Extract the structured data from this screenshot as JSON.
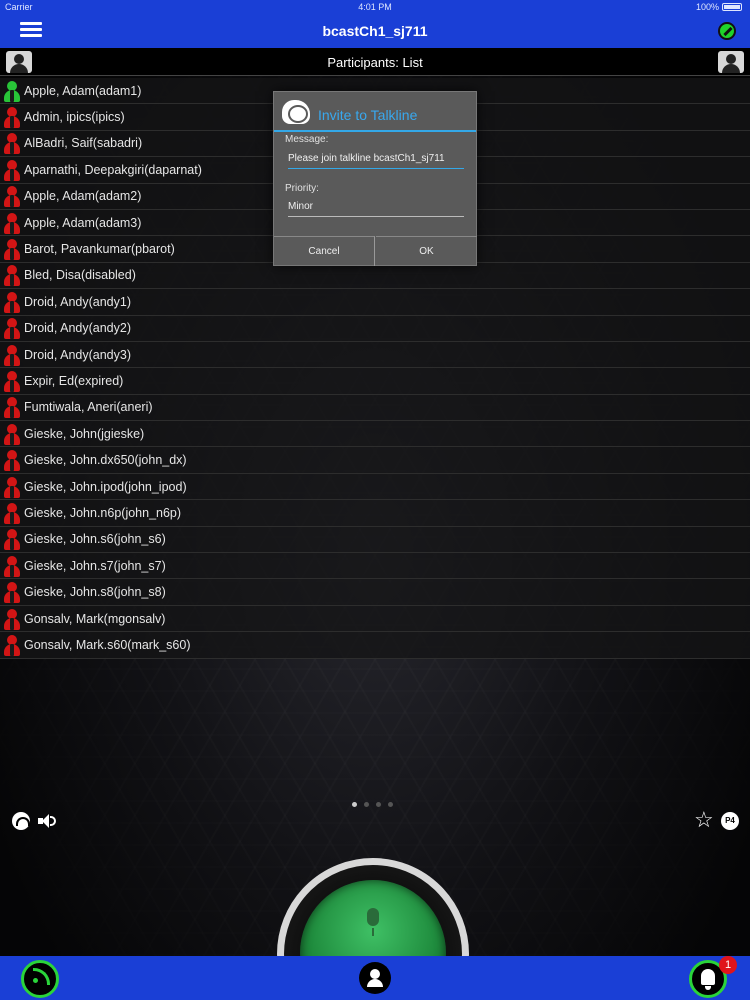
{
  "status_bar": {
    "carrier": "Carrier",
    "time": "4:01 PM",
    "battery": "100%"
  },
  "header": {
    "title": "bcastCh1_sj711"
  },
  "subheader": {
    "label": "Participants: List"
  },
  "participants": [
    {
      "name": "Apple, Adam(adam1)",
      "status": "online"
    },
    {
      "name": "Admin, ipics(ipics)",
      "status": "offline"
    },
    {
      "name": "AlBadri, Saif(sabadri)",
      "status": "offline"
    },
    {
      "name": "Aparnathi, Deepakgiri(daparnat)",
      "status": "offline"
    },
    {
      "name": "Apple, Adam(adam2)",
      "status": "offline"
    },
    {
      "name": "Apple, Adam(adam3)",
      "status": "offline"
    },
    {
      "name": "Barot, Pavankumar(pbarot)",
      "status": "offline"
    },
    {
      "name": "Bled, Disa(disabled)",
      "status": "offline"
    },
    {
      "name": "Droid, Andy(andy1)",
      "status": "offline"
    },
    {
      "name": "Droid, Andy(andy2)",
      "status": "offline"
    },
    {
      "name": "Droid, Andy(andy3)",
      "status": "offline"
    },
    {
      "name": "Expir, Ed(expired)",
      "status": "offline"
    },
    {
      "name": "Fumtiwala, Aneri(aneri)",
      "status": "offline"
    },
    {
      "name": "Gieske, John(jgieske)",
      "status": "offline"
    },
    {
      "name": "Gieske, John.dx650(john_dx)",
      "status": "offline"
    },
    {
      "name": "Gieske, John.ipod(john_ipod)",
      "status": "offline"
    },
    {
      "name": "Gieske, John.n6p(john_n6p)",
      "status": "offline"
    },
    {
      "name": "Gieske, John.s6(john_s6)",
      "status": "offline"
    },
    {
      "name": "Gieske, John.s7(john_s7)",
      "status": "offline"
    },
    {
      "name": "Gieske, John.s8(john_s8)",
      "status": "offline"
    },
    {
      "name": "Gonsalv, Mark(mgonsalv)",
      "status": "offline"
    },
    {
      "name": "Gonsalv, Mark.s60(mark_s60)",
      "status": "offline"
    }
  ],
  "dialog": {
    "title": "Invite to Talkline",
    "message_label": "Message:",
    "message_value": "Please join talkline bcastCh1_sj711",
    "priority_label": "Priority:",
    "priority_value": "Minor",
    "cancel_label": "Cancel",
    "ok_label": "OK"
  },
  "pager": {
    "current_page": 1,
    "total_pages": 4
  },
  "controls": {
    "priority_badge": "P4"
  },
  "bottom_bar": {
    "notification_count": "1"
  },
  "colors": {
    "accent_blue": "#1a3fd6",
    "online_green": "#28c438",
    "offline_red": "#d21515",
    "dialog_accent": "#39a8ee"
  },
  "icons": [
    "menu-icon",
    "ptt-status-icon",
    "participant-avatar-icon",
    "talkline-logo-icon",
    "wifi-icon",
    "speaker-icon",
    "star-icon",
    "microphone-icon",
    "rss-icon",
    "user-icon",
    "bell-icon"
  ]
}
